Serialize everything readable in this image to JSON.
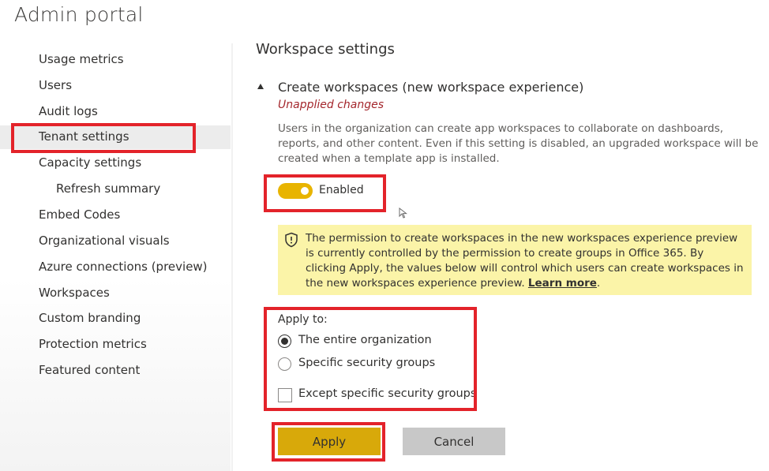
{
  "app": {
    "title": "Admin portal"
  },
  "sidebar": {
    "items": [
      {
        "label": "Usage metrics"
      },
      {
        "label": "Users"
      },
      {
        "label": "Audit logs"
      },
      {
        "label": "Tenant settings"
      },
      {
        "label": "Capacity settings"
      },
      {
        "label": "Refresh summary"
      },
      {
        "label": "Embed Codes"
      },
      {
        "label": "Organizational visuals"
      },
      {
        "label": "Azure connections (preview)"
      },
      {
        "label": "Workspaces"
      },
      {
        "label": "Custom branding"
      },
      {
        "label": "Protection metrics"
      },
      {
        "label": "Featured content"
      }
    ],
    "selected": "Tenant settings"
  },
  "main": {
    "section_title": "Workspace settings",
    "setting": {
      "name": "Create workspaces (new workspace experience)",
      "status": "Unapplied changes",
      "description": "Users in the organization can create app workspaces to collaborate on dashboards, reports, and other content. Even if this setting is disabled, an upgraded workspace will be created when a template app is installed.",
      "toggle": {
        "label": "Enabled",
        "on": true,
        "color": "#e8b400"
      },
      "warning": {
        "icon": "shield-icon",
        "text": "The permission to create workspaces in the new workspaces experience preview is currently controlled by the permission to create groups in Office 365. By clicking Apply, the values below will control which users can create workspaces in the new workspaces experience preview. ",
        "link": "Learn more",
        "link_suffix": "."
      },
      "apply_to": {
        "label": "Apply to:",
        "options": [
          {
            "label": "The entire organization",
            "checked": true
          },
          {
            "label": "Specific security groups",
            "checked": false
          }
        ],
        "except": {
          "label": "Except specific security groups",
          "checked": false
        }
      }
    },
    "buttons": {
      "apply": "Apply",
      "cancel": "Cancel"
    }
  },
  "colors": {
    "highlight": "#e3232a",
    "accent": "#e8b400",
    "warning_bg": "#fbf4a8",
    "unapplied": "#a4262c"
  }
}
